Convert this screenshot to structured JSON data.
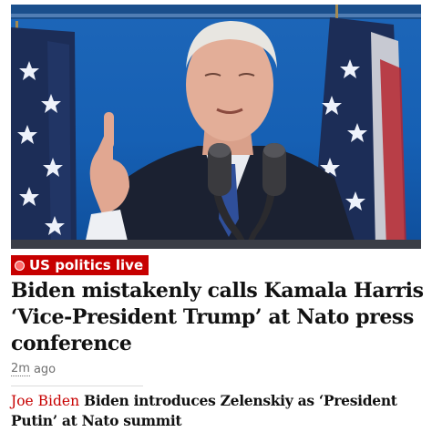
{
  "kicker": {
    "label": "US politics live"
  },
  "headline": {
    "text": "Biden mistakenly calls Kamala Harris ‘Vice-President Trump’ at Nato press conference"
  },
  "timestamp": {
    "value": "2m",
    "suffix": "ago"
  },
  "related": {
    "kicker": "Joe Biden",
    "title": "Biden introduces Zelenskiy as ‘President Putin’ at Nato summit"
  },
  "colors": {
    "accent": "#c70000",
    "photo_background": "#1660b4",
    "text": "#121212",
    "meta_text": "#707070"
  },
  "icons": {
    "live": "live-dot-icon"
  }
}
